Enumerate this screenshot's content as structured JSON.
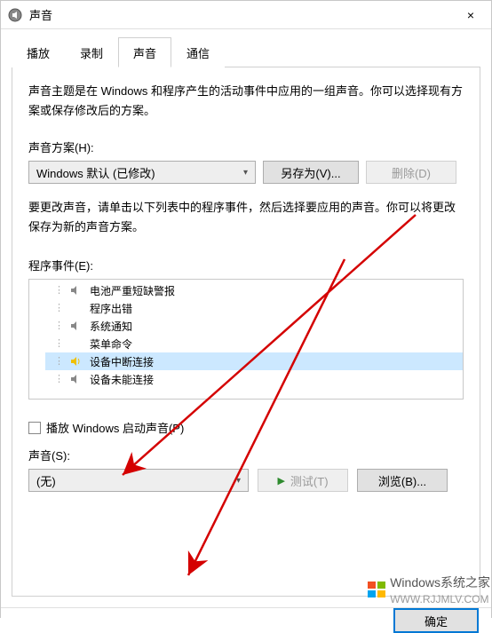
{
  "window": {
    "title": "声音",
    "close": "×"
  },
  "tabs": {
    "play": "播放",
    "record": "录制",
    "sound": "声音",
    "comm": "通信"
  },
  "intro": "声音主题是在 Windows 和程序产生的活动事件中应用的一组声音。你可以选择现有方案或保存修改后的方案。",
  "schemeLabel": "声音方案(H):",
  "schemeValue": "Windows 默认 (已修改)",
  "saveAs": "另存为(V)...",
  "delete": "删除(D)",
  "desc2": "要更改声音，请单击以下列表中的程序事件，然后选择要应用的声音。你可以将更改保存为新的声音方案。",
  "eventsLabel": "程序事件(E):",
  "events": [
    {
      "label": "电池严重短缺警报",
      "icon": "speaker"
    },
    {
      "label": "程序出错",
      "icon": "none"
    },
    {
      "label": "系统通知",
      "icon": "speaker"
    },
    {
      "label": "菜单命令",
      "icon": "none"
    },
    {
      "label": "设备中断连接",
      "icon": "speaker-on",
      "selected": true
    },
    {
      "label": "设备未能连接",
      "icon": "speaker"
    }
  ],
  "startupSound": "播放 Windows 启动声音(P)",
  "soundLabel": "声音(S):",
  "soundValue": "(无)",
  "test": "测试(T)",
  "browse": "浏览(B)...",
  "ok": "确定",
  "watermark": {
    "t1": "Windows",
    "t2": "系统之家",
    "url": "WWW.RJJMLV.COM"
  }
}
